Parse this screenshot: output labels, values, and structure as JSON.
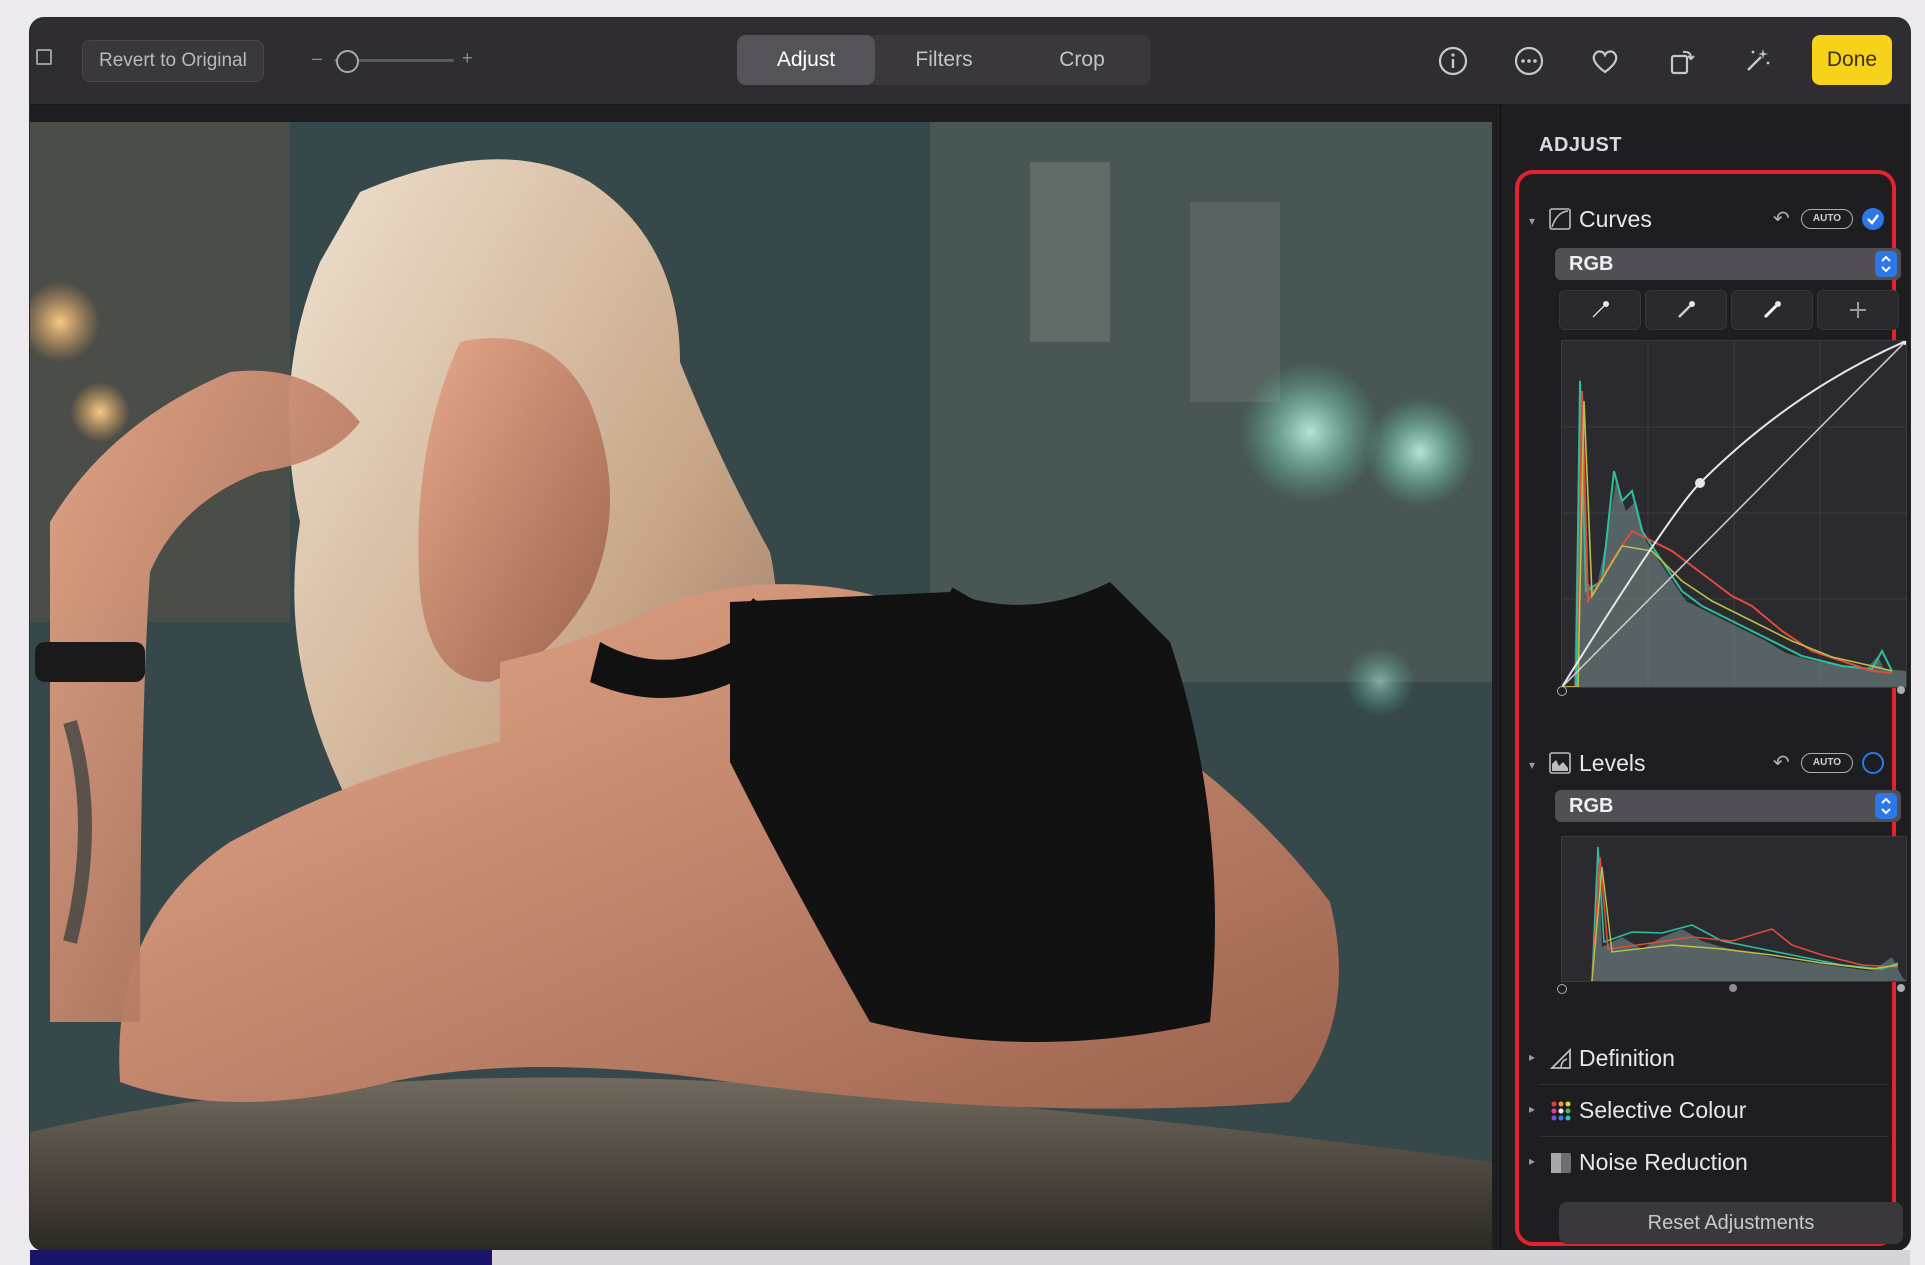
{
  "toolbar": {
    "revert_label": "Revert to Original",
    "zoom_minus": "–",
    "zoom_plus": "+",
    "tabs": [
      {
        "label": "Adjust",
        "active": true
      },
      {
        "label": "Filters",
        "active": false
      },
      {
        "label": "Crop",
        "active": false
      }
    ],
    "icons": [
      "info-icon",
      "more-icon",
      "favorite-heart-icon",
      "rotate-icon",
      "magic-wand-icon"
    ],
    "done_label": "Done"
  },
  "panel": {
    "title": "ADJUST",
    "curves": {
      "label": "Curves",
      "auto_label": "AUTO",
      "enabled": true,
      "channel": "RGB",
      "pickers": [
        "black-point-eyedropper-icon",
        "gray-point-eyedropper-icon",
        "white-point-eyedropper-icon",
        "add-point-icon"
      ]
    },
    "levels": {
      "label": "Levels",
      "auto_label": "AUTO",
      "enabled": false,
      "channel": "RGB"
    },
    "items": [
      {
        "label": "Definition",
        "icon": "definition-icon"
      },
      {
        "label": "Selective Colour",
        "icon": "selective-colour-icon"
      },
      {
        "label": "Noise Reduction",
        "icon": "noise-reduction-icon"
      }
    ],
    "reset_label": "Reset Adjustments"
  },
  "colors": {
    "accent_blue": "#2d77e6",
    "done_yellow": "#f7d21b",
    "highlight_red": "#e0242e"
  }
}
